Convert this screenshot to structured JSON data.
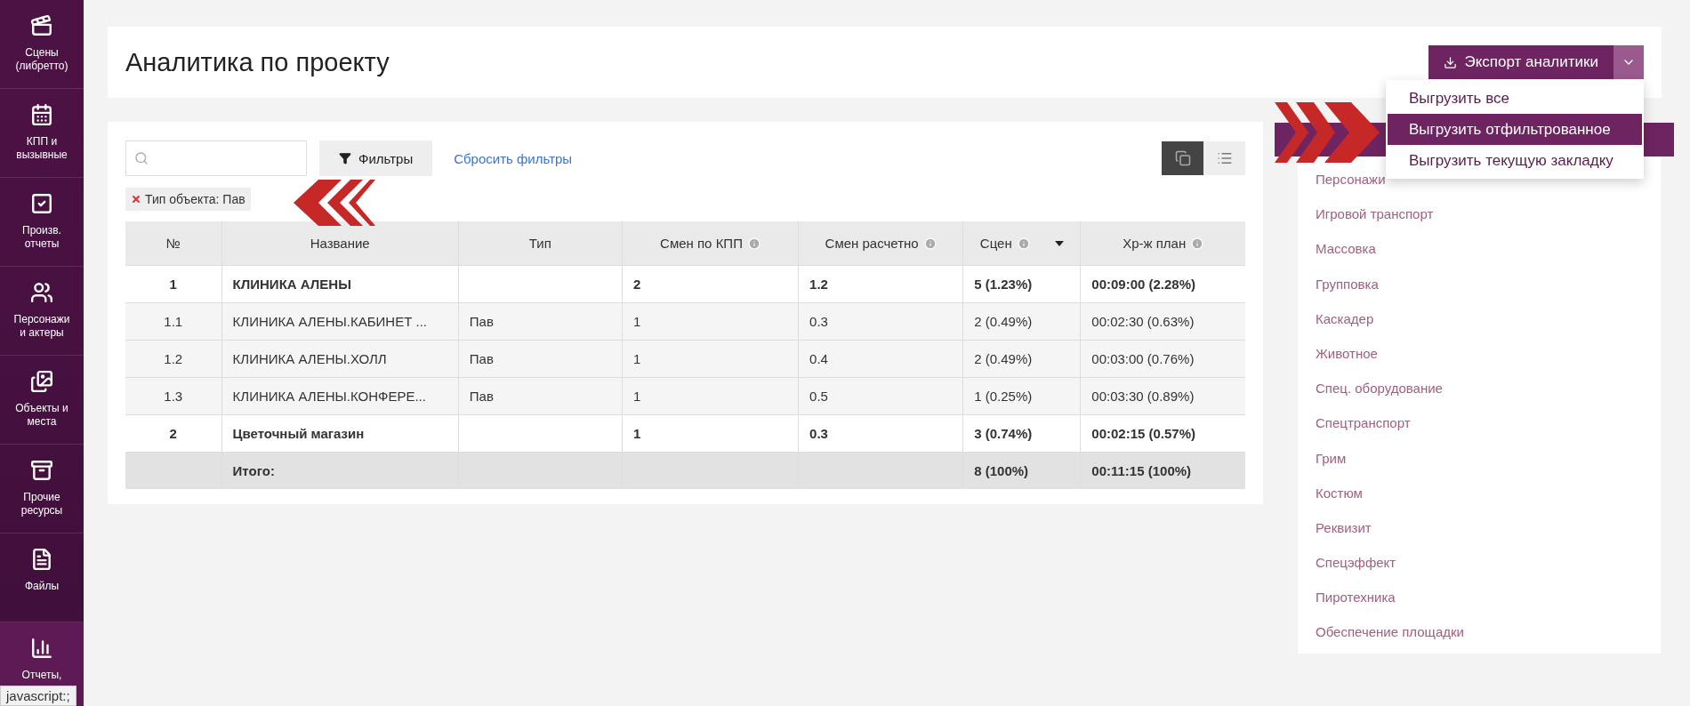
{
  "sidebar": {
    "items": [
      {
        "label": "Сцены (либретто)",
        "selected": false
      },
      {
        "label": "КПП и вызывные",
        "selected": false
      },
      {
        "label": "Произв. отчеты",
        "selected": false
      },
      {
        "label": "Персонажи и актеры",
        "selected": false
      },
      {
        "label": "Объекты и места",
        "selected": false
      },
      {
        "label": "Прочие ресурсы",
        "selected": false
      },
      {
        "label": "Файлы",
        "selected": false
      },
      {
        "label": "Отчеты,",
        "selected": true
      }
    ]
  },
  "header": {
    "title": "Аналитика по проекту",
    "export_button": "Экспорт аналитики",
    "export_menu": [
      {
        "label": "Выгрузить все",
        "selected": false
      },
      {
        "label": "Выгрузить отфильтрованное",
        "selected": true
      },
      {
        "label": "Выгрузить текущую закладку",
        "selected": false
      }
    ]
  },
  "toolbar": {
    "filters_button": "Фильтры",
    "reset_link": "Сбросить фильтры",
    "views": [
      {
        "selected": true
      },
      {
        "selected": false
      }
    ]
  },
  "active_filters": [
    {
      "label": "Тип объекта:",
      "value": "Пав"
    }
  ],
  "table": {
    "columns": [
      {
        "label": "№",
        "info": false,
        "sorted": false
      },
      {
        "label": "Название",
        "info": false,
        "sorted": false
      },
      {
        "label": "Тип",
        "info": false,
        "sorted": false
      },
      {
        "label": "Смен по КПП",
        "info": true,
        "sorted": false
      },
      {
        "label": "Смен расчетно",
        "info": true,
        "sorted": false
      },
      {
        "label": "Сцен",
        "info": true,
        "sorted": true
      },
      {
        "label": "Хр-ж план",
        "info": true,
        "sorted": false
      }
    ],
    "rows": [
      {
        "kind": "group",
        "cells": [
          "1",
          "КЛИНИКА АЛЕНЫ",
          "",
          "2",
          "1.2",
          "5 (1.23%)",
          "00:09:00 (2.28%)"
        ]
      },
      {
        "kind": "item",
        "cells": [
          "1.1",
          "КЛИНИКА АЛЕНЫ.КАБИНЕТ ...",
          "Пав",
          "1",
          "0.3",
          "2 (0.49%)",
          "00:02:30 (0.63%)"
        ]
      },
      {
        "kind": "item",
        "cells": [
          "1.2",
          "КЛИНИКА АЛЕНЫ.ХОЛЛ",
          "Пав",
          "1",
          "0.4",
          "2 (0.49%)",
          "00:03:00 (0.76%)"
        ]
      },
      {
        "kind": "item",
        "cells": [
          "1.3",
          "КЛИНИКА АЛЕНЫ.КОНФЕРЕ...",
          "Пав",
          "1",
          "0.5",
          "1 (0.25%)",
          "00:03:30 (0.89%)"
        ]
      },
      {
        "kind": "group",
        "cells": [
          "2",
          "Цветочный магазин",
          "",
          "1",
          "0.3",
          "3 (0.74%)",
          "00:02:15 (0.57%)"
        ]
      },
      {
        "kind": "total",
        "cells": [
          "",
          "Итого:",
          "",
          "",
          "",
          "8 (100%)",
          "00:11:15 (100%)"
        ]
      }
    ]
  },
  "categories": {
    "items": [
      {
        "label": "Персонажи"
      },
      {
        "label": "Игровой транспорт"
      },
      {
        "label": "Массовка"
      },
      {
        "label": "Групповка"
      },
      {
        "label": "Каскадер"
      },
      {
        "label": "Животное"
      },
      {
        "label": "Спец. оборудование"
      },
      {
        "label": "Спецтранспорт"
      },
      {
        "label": "Грим"
      },
      {
        "label": "Костюм"
      },
      {
        "label": "Реквизит"
      },
      {
        "label": "Спецэффект"
      },
      {
        "label": "Пиротехника"
      },
      {
        "label": "Обеспечение площадки"
      }
    ]
  },
  "status_bar": {
    "text": "javascript:;"
  }
}
